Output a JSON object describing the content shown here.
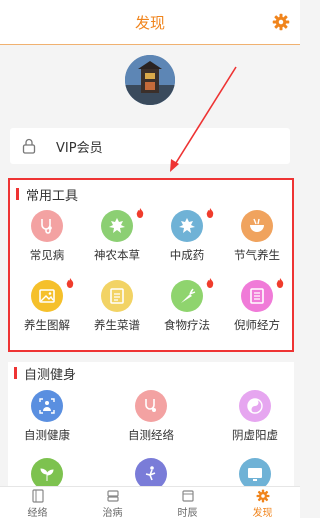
{
  "header": {
    "title": "发现"
  },
  "vip": {
    "label": "VIP会员"
  },
  "tools": {
    "title": "常用工具",
    "items": [
      {
        "label": "常见病",
        "color": "#f3a2a2",
        "icon": "stethoscope-icon",
        "hot": false
      },
      {
        "label": "神农本草",
        "color": "#8ccf73",
        "icon": "leaf-icon",
        "hot": true
      },
      {
        "label": "中成药",
        "color": "#6fb2d6",
        "icon": "pill-icon",
        "hot": true
      },
      {
        "label": "节气养生",
        "color": "#f0a35e",
        "icon": "bowl-icon",
        "hot": false
      },
      {
        "label": "养生图解",
        "color": "#f5c02b",
        "icon": "picture-icon",
        "hot": true
      },
      {
        "label": "养生菜谱",
        "color": "#f2d365",
        "icon": "recipe-icon",
        "hot": false
      },
      {
        "label": "食物疗法",
        "color": "#8fd46e",
        "icon": "carrot-icon",
        "hot": true
      },
      {
        "label": "倪师经方",
        "color": "#f07bd8",
        "icon": "book-icon",
        "hot": true
      }
    ]
  },
  "self_test": {
    "title": "自测健身",
    "items": [
      {
        "label": "自测健康",
        "color": "#5a8fe0",
        "icon": "body-scan-icon"
      },
      {
        "label": "自测经络",
        "color": "#f3a2a2",
        "icon": "meridian-icon"
      },
      {
        "label": "阴虚阳虚",
        "color": "#e6a6f0",
        "icon": "yin-yang-icon"
      }
    ],
    "partial_items": [
      {
        "color": "#7dc24f",
        "icon": "plant-icon"
      },
      {
        "color": "#7a7cd8",
        "icon": "exercise-icon"
      },
      {
        "color": "#6fb2d6",
        "icon": "screen-icon"
      }
    ]
  },
  "tabbar": {
    "tabs": [
      {
        "label": "经络",
        "active": false
      },
      {
        "label": "治病",
        "active": false
      },
      {
        "label": "时辰",
        "active": false
      },
      {
        "label": "发现",
        "active": true
      }
    ]
  },
  "colors": {
    "accent": "#f0841c",
    "highlight": "#e33333"
  }
}
